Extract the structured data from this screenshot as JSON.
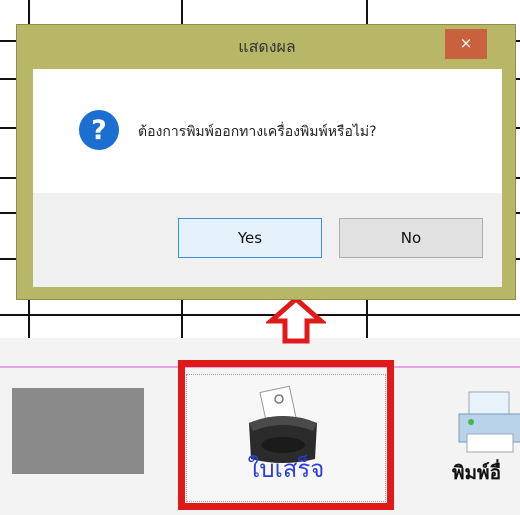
{
  "dialog": {
    "title": "แสดงผล",
    "close_symbol": "×",
    "message": "ต้องการพิมพ์ออกทางเครื่องพิมพ์หรือไม่?",
    "question_icon_glyph": "?",
    "yes_label": "Yes",
    "no_label": "No",
    "frame_color": "#b7b767",
    "close_color": "#c9613f"
  },
  "toolbar": {
    "receipt_label": "ใบเสร็จ",
    "receipt_icon": "receipt-printer-icon",
    "print_other_label": "พิมพ์อื่",
    "print_other_icon": "printer-icon",
    "highlight_color": "#e01919"
  },
  "annotation": {
    "arrow_icon": "up-arrow-icon",
    "arrow_color": "#e01919"
  }
}
